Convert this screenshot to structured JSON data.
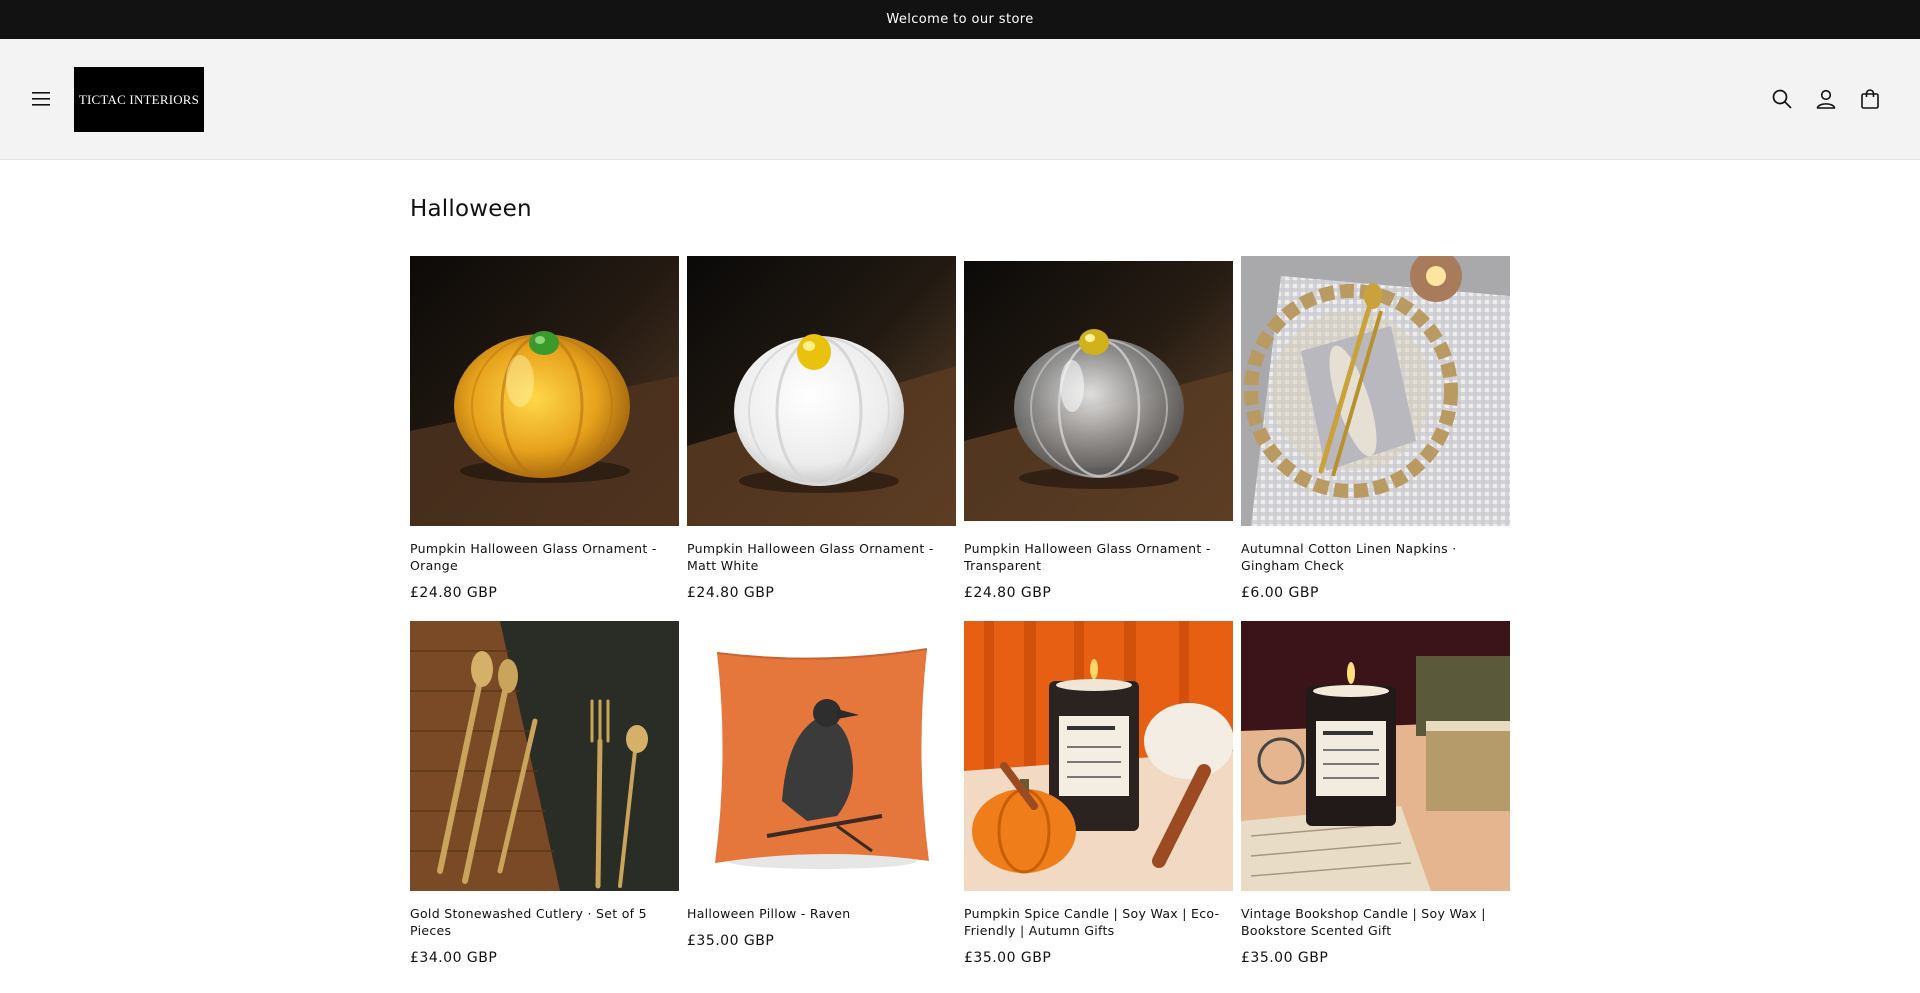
{
  "announcement": {
    "text": "Welcome to our store"
  },
  "header": {
    "logo_text": "TICTAC INTERIORS",
    "icons": [
      "menu-icon",
      "search-icon",
      "account-icon",
      "cart-icon"
    ]
  },
  "collection": {
    "title": "Halloween",
    "products": [
      {
        "title": "Pumpkin Halloween Glass Ornament - Orange",
        "price": "£24.80 GBP"
      },
      {
        "title": "Pumpkin Halloween Glass Ornament - Matt White",
        "price": "£24.80 GBP"
      },
      {
        "title": "Pumpkin Halloween Glass Ornament - Transparent",
        "price": "£24.80 GBP"
      },
      {
        "title": "Autumnal Cotton Linen Napkins · Gingham Check",
        "price": "£6.00 GBP"
      },
      {
        "title": "Gold Stonewashed Cutlery · Set of 5 Pieces",
        "price": "£34.00 GBP"
      },
      {
        "title": "Halloween Pillow - Raven",
        "price": "£35.00 GBP"
      },
      {
        "title": "Pumpkin Spice Candle | Soy Wax | Eco-Friendly | Autumn Gifts",
        "price": "£35.00 GBP"
      },
      {
        "title": "Vintage Bookshop Candle | Soy Wax | Bookstore Scented Gift",
        "price": "£35.00 GBP"
      }
    ]
  },
  "colors": {
    "announcement_bg": "#121212",
    "header_bg": "#f3f3f3",
    "text": "#121212"
  }
}
